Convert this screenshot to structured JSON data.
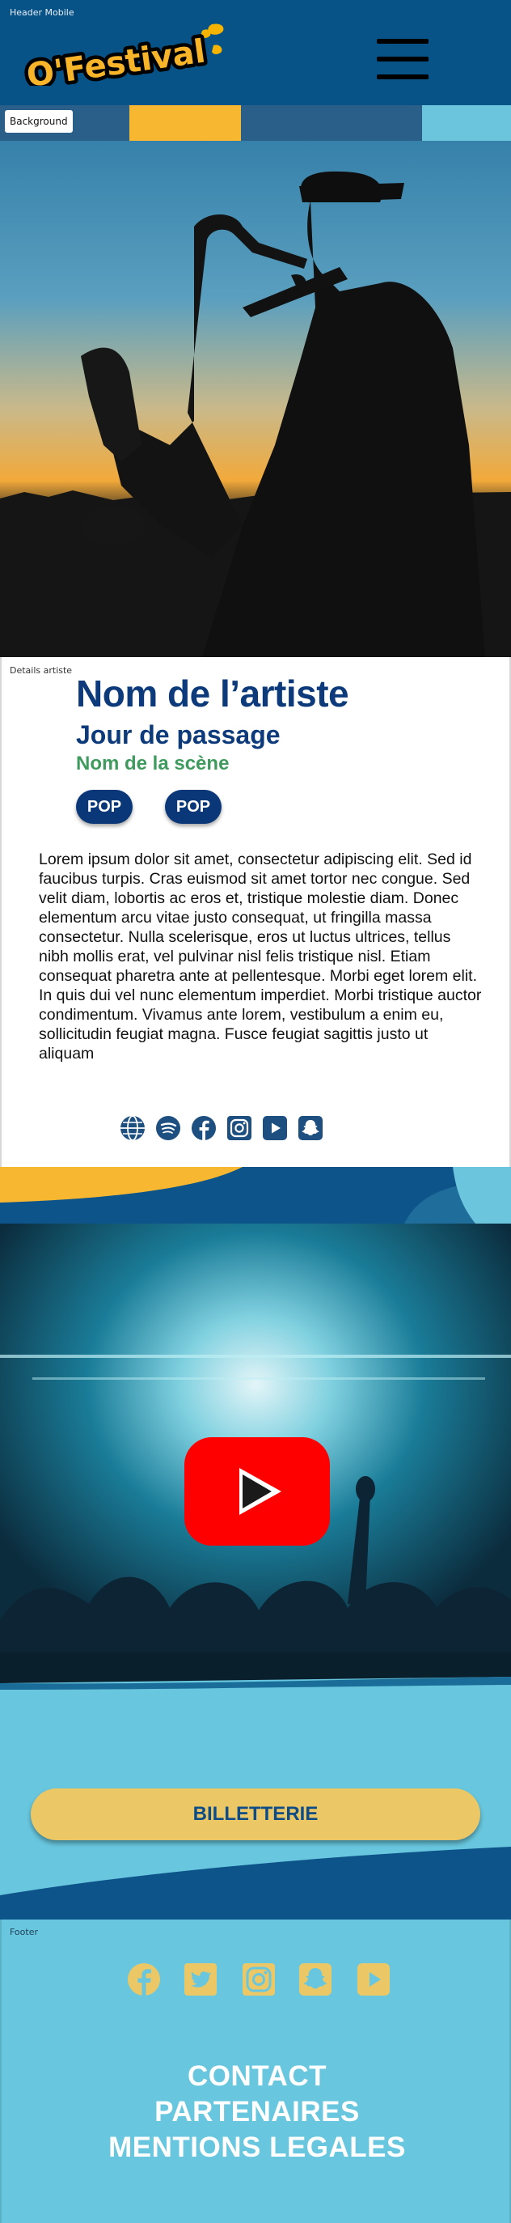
{
  "frames": {
    "header": "Header Mobile",
    "background": "Background",
    "details": "Details artiste",
    "footer": "Footer"
  },
  "header": {
    "logo_text": "O'Festival",
    "menu_icon": "hamburger-menu-icon"
  },
  "artist": {
    "name": "Nom de l’artiste",
    "day": "Jour de passage",
    "stage": "Nom de la scène",
    "tags": [
      "POP",
      "POP"
    ],
    "bio": "Lorem ipsum dolor sit amet, consectetur adipiscing elit. Sed id faucibus turpis. Cras euismod sit amet tortor nec congue. Sed velit diam, lobortis ac eros et, tristique molestie diam. Donec elementum arcu vitae justo consequat, ut fringilla massa consectetur. Nulla scelerisque, eros ut luctus ultrices, tellus nibh mollis erat, vel pulvinar nisl felis tristique nisl. Etiam consequat pharetra ante at pellentesque. Morbi eget lorem elit. In quis dui vel nunc elementum imperdiet. Morbi tristique auctor condimentum. Vivamus ante lorem, vestibulum a enim eu, sollicitudin feugiat magna. Fusce feugiat sagittis justo ut aliquam",
    "socials": [
      "globe-icon",
      "spotify-icon",
      "facebook-icon",
      "instagram-icon",
      "youtube-icon",
      "snapchat-icon"
    ]
  },
  "video": {
    "play_icon": "youtube-play-icon"
  },
  "ticket": {
    "label": "BILLETTERIE"
  },
  "footer": {
    "socials": [
      "facebook-icon",
      "twitter-icon",
      "instagram-icon",
      "snapchat-icon",
      "youtube-icon"
    ],
    "links": [
      "CONTACT",
      "PARTENAIRES",
      "MENTIONS LEGALES"
    ]
  },
  "colors": {
    "navy": "#075388",
    "dark_blue": "#0a3778",
    "yellow": "#ecc765",
    "sky": "#68c7de",
    "green": "#3f9a5d",
    "youtube_red": "#ff0000"
  }
}
